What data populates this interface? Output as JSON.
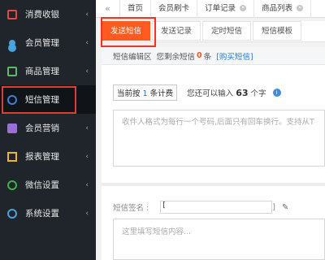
{
  "sidebar": {
    "items": [
      {
        "label": "消费收银",
        "icon": "cart-icon"
      },
      {
        "label": "会员管理",
        "icon": "member-icon"
      },
      {
        "label": "商品管理",
        "icon": "goods-icon"
      },
      {
        "label": "短信管理",
        "icon": "sms-icon"
      },
      {
        "label": "会员营销",
        "icon": "gift-icon"
      },
      {
        "label": "报表管理",
        "icon": "report-icon"
      },
      {
        "label": "微信设置",
        "icon": "wechat-icon"
      },
      {
        "label": "系统设置",
        "icon": "gear-icon"
      }
    ],
    "arrow": "‹",
    "active_index": 3
  },
  "topbar": {
    "back": "«",
    "tabs": [
      {
        "label": "首页",
        "closable": false
      },
      {
        "label": "会员刷卡",
        "closable": false
      },
      {
        "label": "订单记录",
        "closable": true
      },
      {
        "label": "商品列表",
        "closable": true
      }
    ],
    "close_glyph": "×"
  },
  "subtabs": {
    "items": [
      "发送短信",
      "发送记录",
      "定时短信",
      "短信模板"
    ],
    "active_index": 0
  },
  "panel": {
    "title": "短信编辑区",
    "remaining_prefix": "您剩余短信",
    "remaining_count": "0",
    "remaining_unit": "条",
    "buy_link": "[购买短信]",
    "billing_prefix": "当前按",
    "billing_count": "1",
    "billing_suffix": "条计费",
    "input_prefix": "您还可以输入",
    "input_count": "63",
    "input_suffix": "个字",
    "info_glyph": "i",
    "recipients_placeholder": "收件人格式为每行一个号码,后面只有回车换行。支持从T",
    "sign_label": "短信签名 :",
    "sign_value": "[",
    "sign_end": "]",
    "edit_glyph": "✎",
    "content_placeholder": "这里填写短信内容..."
  },
  "colors": {
    "sidebar_bg": "#1f252b",
    "accent": "#ff5a1f",
    "highlight": "#e23b35",
    "link": "#2a7ad6"
  }
}
